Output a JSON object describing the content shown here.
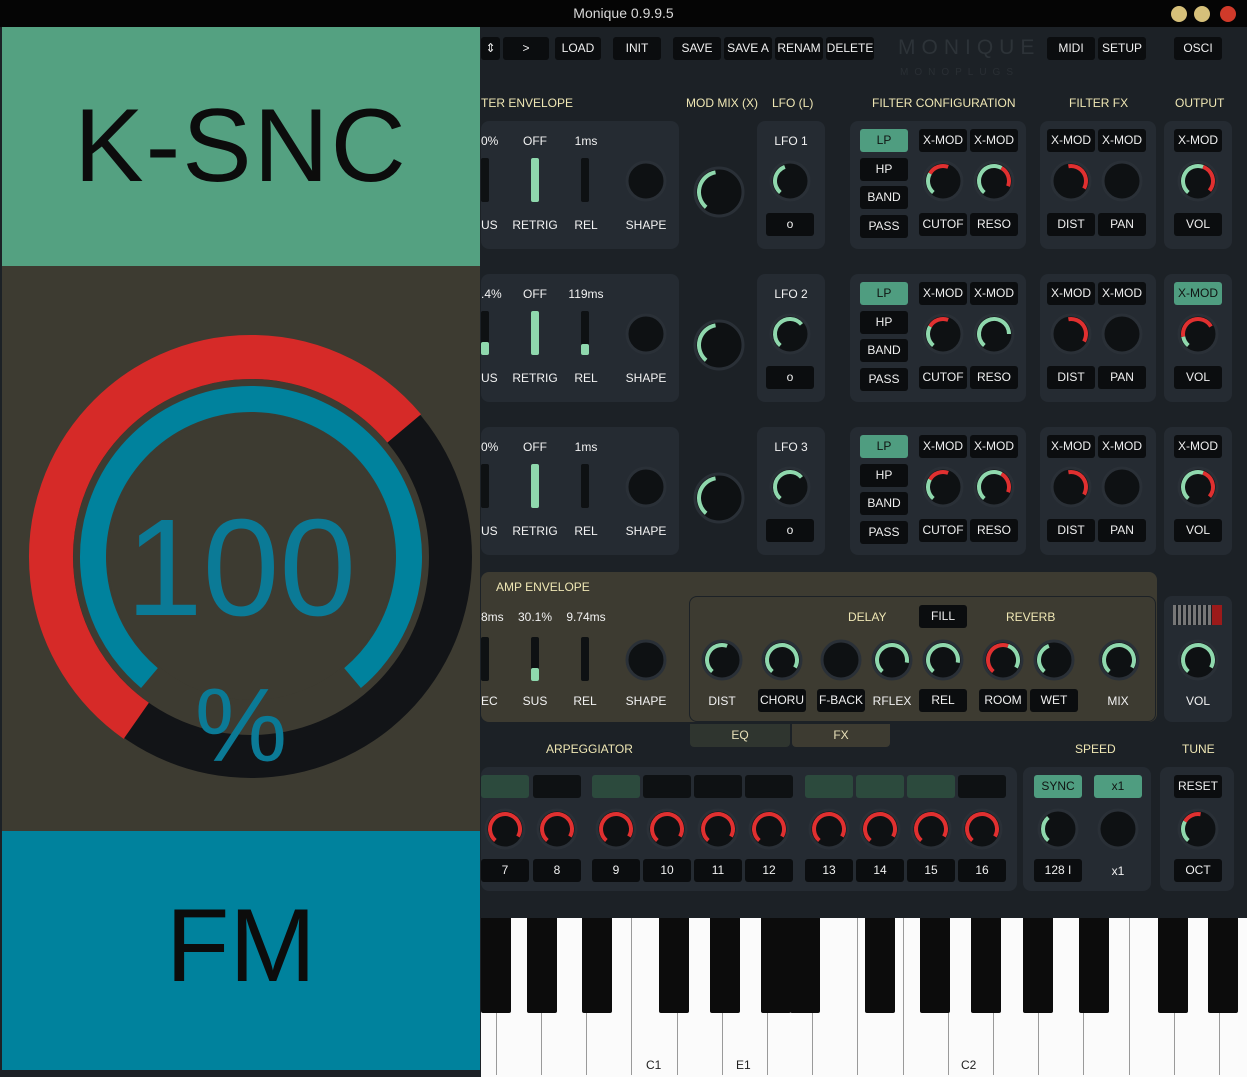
{
  "window": {
    "title": "Monique 0.9.9.5"
  },
  "toolbar": {
    "prev": "",
    "next": ">",
    "load": "LOAD",
    "init": "INIT",
    "save": "SAVE",
    "save_as": "SAVE A",
    "rename": "RENAM",
    "delete": "DELETE",
    "midi": "MIDI",
    "setup": "SETUP",
    "osci": "OSCI"
  },
  "logo": {
    "name": "MONIQUE",
    "sub": "MONOPLUGS"
  },
  "sections": {
    "filter_envelope": "TER ENVELOPE",
    "mod_mix": "MOD MIX (X)",
    "lfo": "LFO (L)",
    "filter_config": "FILTER CONFIGURATION",
    "filter_fx": "FILTER FX",
    "output": "OUTPUT",
    "amp_envelope": "AMP ENVELOPE",
    "delay": "DELAY",
    "reverb": "REVERB",
    "arpeggiator": "ARPEGGIATOR",
    "speed": "SPEED",
    "tune": "TUNE"
  },
  "filters": [
    {
      "env_sus_val": "0%",
      "retrig_val": "OFF",
      "rel_val": "1ms",
      "sus_label": "US",
      "retrig_label": "RETRIG",
      "rel_label": "REL",
      "shape_label": "SHAPE",
      "sus_level": 0.0,
      "rel_level": 0.0,
      "lfo_label": "LFO 1",
      "lfo_btn": "o",
      "types": [
        "LP",
        "HP",
        "BAND",
        "PASS"
      ],
      "xmod1": "X-MOD",
      "xmod2": "X-MOD",
      "cutoff": "CUTOF",
      "reso": "RESO",
      "fx_xmod1": "X-MOD",
      "fx_xmod2": "X-MOD",
      "dist": "DIST",
      "pan": "PAN",
      "out_xmod": "X-MOD",
      "vol": "VOL",
      "out_xmod_active": false
    },
    {
      "env_sus_val": ".4%",
      "retrig_val": "OFF",
      "rel_val": "119ms",
      "sus_label": "US",
      "retrig_label": "RETRIG",
      "rel_label": "REL",
      "shape_label": "SHAPE",
      "sus_level": 0.3,
      "rel_level": 0.25,
      "lfo_label": "LFO 2",
      "lfo_btn": "o",
      "types": [
        "LP",
        "HP",
        "BAND",
        "PASS"
      ],
      "xmod1": "X-MOD",
      "xmod2": "X-MOD",
      "cutoff": "CUTOF",
      "reso": "RESO",
      "fx_xmod1": "X-MOD",
      "fx_xmod2": "X-MOD",
      "dist": "DIST",
      "pan": "PAN",
      "out_xmod": "X-MOD",
      "vol": "VOL",
      "out_xmod_active": true
    },
    {
      "env_sus_val": "0%",
      "retrig_val": "OFF",
      "rel_val": "1ms",
      "sus_label": "US",
      "retrig_label": "RETRIG",
      "rel_label": "REL",
      "shape_label": "SHAPE",
      "sus_level": 0.0,
      "rel_level": 0.0,
      "lfo_label": "LFO 3",
      "lfo_btn": "o",
      "types": [
        "LP",
        "HP",
        "BAND",
        "PASS"
      ],
      "xmod1": "X-MOD",
      "xmod2": "X-MOD",
      "cutoff": "CUTOF",
      "reso": "RESO",
      "fx_xmod1": "X-MOD",
      "fx_xmod2": "X-MOD",
      "dist": "DIST",
      "pan": "PAN",
      "out_xmod": "X-MOD",
      "vol": "VOL",
      "out_xmod_active": false
    }
  ],
  "amp_env": {
    "dec_val": "8ms",
    "sus_val": "30.1%",
    "rel_val": "9.74ms",
    "dec_label": "EC",
    "sus_label": "SUS",
    "rel_label": "REL",
    "shape_label": "SHAPE",
    "sus_level": 0.3
  },
  "fx": {
    "fill": "FILL",
    "dist": "DIST",
    "chorus": "CHORU",
    "feedback": "F-BACK",
    "reflex": "RFLEX",
    "rel": "REL",
    "room": "ROOM",
    "wet": "WET",
    "mix": "MIX",
    "tab_eq": "EQ",
    "tab_fx": "FX",
    "master_vol": "VOL"
  },
  "arp": {
    "steps": [
      "7",
      "8",
      "9",
      "10",
      "11",
      "12",
      "13",
      "14",
      "15",
      "16"
    ]
  },
  "speed": {
    "sync": "SYNC",
    "mult": "x1",
    "bpm_label": "128 I",
    "mult_label": "x1"
  },
  "tune": {
    "reset": "RESET",
    "oct": "OCT"
  },
  "keyboard": {
    "labels": [
      "C1",
      "E1",
      "C2"
    ]
  },
  "overlay": {
    "parameter": "K-SNC",
    "value": "100",
    "unit": "%",
    "source": "FM",
    "value_fraction": 1.0
  },
  "colors": {
    "accent_green": "#54a181",
    "knob_green": "#8fd8ad",
    "knob_red": "#e03030",
    "overlay_blue": "#00829d",
    "overlay_red": "#d62a28"
  }
}
